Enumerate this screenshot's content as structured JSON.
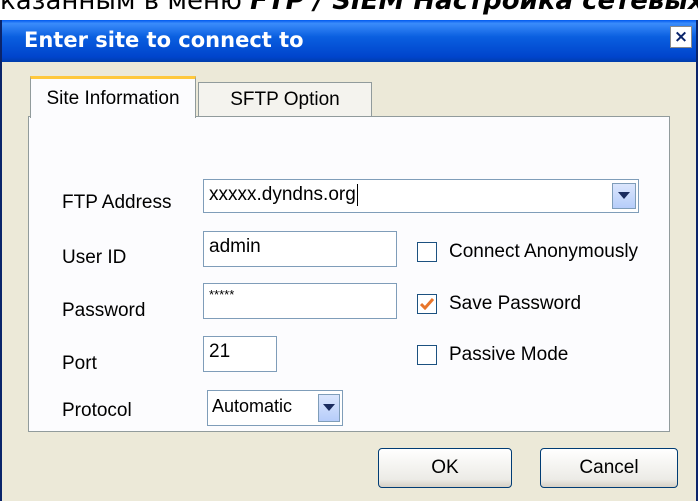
{
  "background_text": {
    "prefix": "казанным в меню ",
    "bold": "FTP / SIEM Настройка сетевых"
  },
  "dialog": {
    "title": "Enter site to connect to",
    "close_glyph": "×"
  },
  "tabs": [
    {
      "label": "Site Information",
      "active": true
    },
    {
      "label": "SFTP Option",
      "active": false
    }
  ],
  "form": {
    "ftp_address": {
      "label": "FTP Address",
      "value": "xxxxx.dyndns.org"
    },
    "user_id": {
      "label": "User ID",
      "value": "admin"
    },
    "password": {
      "label": "Password",
      "value": "*****"
    },
    "port": {
      "label": "Port",
      "value": "21"
    },
    "protocol": {
      "label": "Protocol",
      "value": "Automatic"
    }
  },
  "checkboxes": {
    "connect_anonymously": {
      "label": "Connect Anonymously",
      "checked": false
    },
    "save_password": {
      "label": "Save Password",
      "checked": true
    },
    "passive_mode": {
      "label": "Passive Mode",
      "checked": false
    }
  },
  "buttons": {
    "ok": "OK",
    "cancel": "Cancel"
  },
  "colors": {
    "titlebar": "#0a5fe0",
    "check_mark": "#e8752a",
    "active_tab_accent": "#ffc83c"
  }
}
